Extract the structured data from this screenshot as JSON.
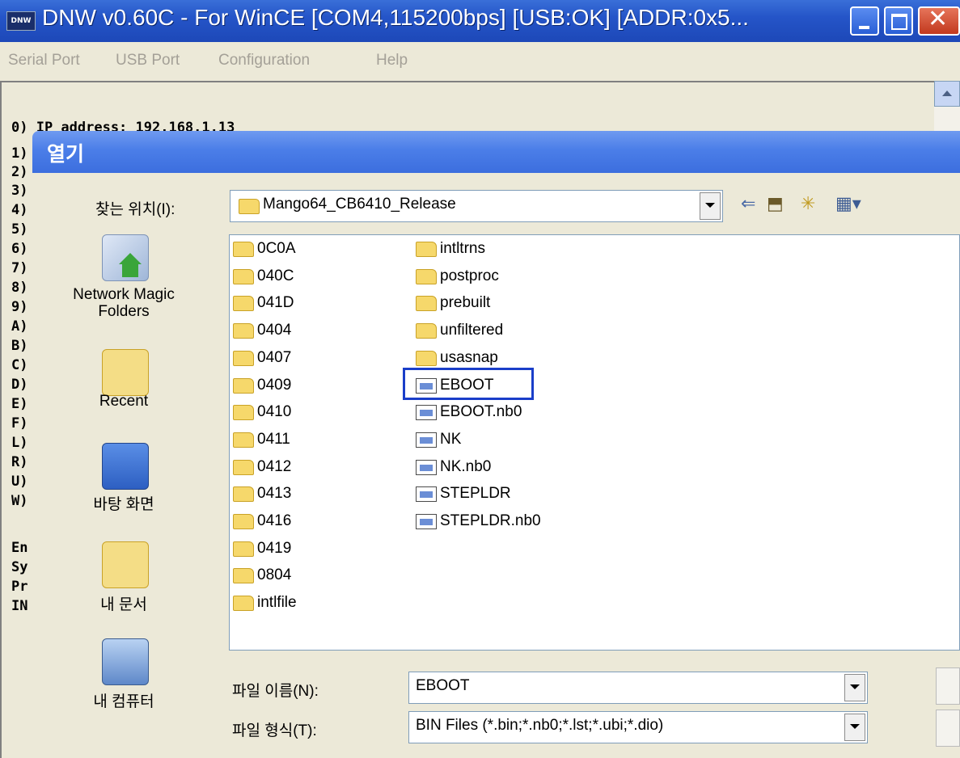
{
  "window": {
    "title": "DNW v0.60C - For WinCE   [COM4,115200bps] [USB:OK] [ADDR:0x5...",
    "app_icon_text": "DNW"
  },
  "menu": [
    "Serial Port",
    "USB Port",
    "Configuration",
    "Help"
  ],
  "console": {
    "lines": [
      "0) IP address: 192.168.1.13",
      "1)",
      "2)",
      "3)",
      "4)",
      "5)",
      "6)",
      "7)",
      "8)",
      "9)",
      "A)",
      "B)",
      "C)",
      "D)",
      "E)",
      "F)",
      "L)",
      "R)",
      "U)",
      "W)",
      "",
      "En",
      "Sy",
      "Pr",
      "IN"
    ]
  },
  "dialog": {
    "title": "열기",
    "look_in_label": "찾는 위치(I):",
    "look_in_value": "Mango64_CB6410_Release",
    "places": [
      "Network Magic Folders",
      "Recent",
      "바탕 화면",
      "내 문서",
      "내 컴퓨터"
    ],
    "files_col1": [
      "0C0A",
      "040C",
      "041D",
      "0404",
      "0407",
      "0409",
      "0410",
      "0411",
      "0412",
      "0413",
      "0416",
      "0419",
      "0804",
      "intlfile"
    ],
    "files_col2": [
      {
        "name": "intltrns",
        "type": "folder"
      },
      {
        "name": "postproc",
        "type": "folder"
      },
      {
        "name": "prebuilt",
        "type": "folder"
      },
      {
        "name": "unfiltered",
        "type": "folder"
      },
      {
        "name": "usasnap",
        "type": "folder"
      },
      {
        "name": "EBOOT",
        "type": "file"
      },
      {
        "name": "EBOOT.nb0",
        "type": "file"
      },
      {
        "name": "NK",
        "type": "file"
      },
      {
        "name": "NK.nb0",
        "type": "file"
      },
      {
        "name": "STEPLDR",
        "type": "file"
      },
      {
        "name": "STEPLDR.nb0",
        "type": "file"
      }
    ],
    "selected_file": "EBOOT",
    "filename_label": "파일 이름(N):",
    "filename_value": "EBOOT",
    "filetype_label": "파일 형식(T):",
    "filetype_value": "BIN Files (*.bin;*.nb0;*.lst;*.ubi;*.dio)"
  }
}
